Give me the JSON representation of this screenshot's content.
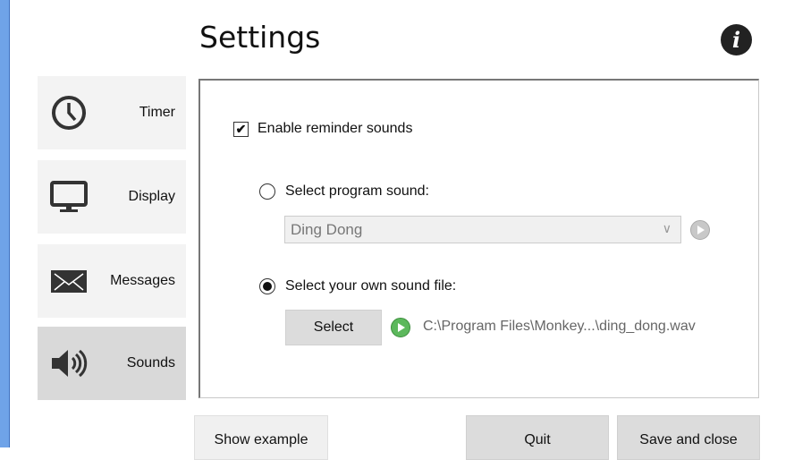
{
  "header": {
    "title": "Settings",
    "info_icon": "i"
  },
  "sidebar": {
    "items": [
      {
        "label": "Timer",
        "icon": "clock-icon"
      },
      {
        "label": "Display",
        "icon": "monitor-icon"
      },
      {
        "label": "Messages",
        "icon": "envelope-icon"
      },
      {
        "label": "Sounds",
        "icon": "speaker-icon",
        "active": true
      }
    ]
  },
  "sounds": {
    "enable_label": "Enable reminder sounds",
    "enable_checked": true,
    "program_sound_label": "Select program sound:",
    "program_sound_value": "Ding Dong",
    "own_file_label": "Select your own sound file:",
    "select_button": "Select",
    "file_path": "C:\\Program Files\\Monkey...\\ding_dong.wav",
    "selected_option": "own_file"
  },
  "footer": {
    "show_example": "Show example",
    "quit": "Quit",
    "save_close": "Save and close"
  },
  "colors": {
    "play_active": "#5cb85c",
    "play_disabled": "#c8c8c8",
    "active_nav": "#d9d9d9"
  }
}
